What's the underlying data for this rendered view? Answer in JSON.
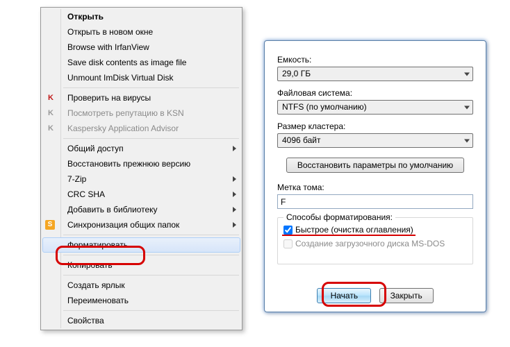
{
  "menu": {
    "items": [
      {
        "label": "Открыть",
        "bold": true
      },
      {
        "label": "Открыть в новом окне"
      },
      {
        "label": "Browse with IrfanView"
      },
      {
        "label": "Save disk contents as image file"
      },
      {
        "label": "Unmount ImDisk Virtual Disk"
      },
      {
        "sep": true
      },
      {
        "label": "Проверить на вирусы",
        "icon": "kas"
      },
      {
        "label": "Посмотреть репутацию в KSN",
        "icon": "kas2",
        "disabled": true
      },
      {
        "label": "Kaspersky Application Advisor",
        "icon": "kas2",
        "disabled": true
      },
      {
        "sep": true
      },
      {
        "label": "Общий доступ",
        "submenu": true
      },
      {
        "label": "Восстановить прежнюю версию"
      },
      {
        "label": "7-Zip",
        "submenu": true
      },
      {
        "label": "CRC SHA",
        "submenu": true
      },
      {
        "label": "Добавить в библиотеку",
        "submenu": true
      },
      {
        "label": "Синхронизация общих папок",
        "icon": "s",
        "submenu": true
      },
      {
        "sep": true
      },
      {
        "label": "Форматировать...",
        "highlight": true,
        "key": "format"
      },
      {
        "sep": true
      },
      {
        "label": "Копировать"
      },
      {
        "sep": true
      },
      {
        "label": "Создать ярлык"
      },
      {
        "label": "Переименовать"
      },
      {
        "sep": true
      },
      {
        "label": "Свойства"
      }
    ]
  },
  "dialog": {
    "capacity_label": "Емкость:",
    "capacity_value": "29,0 ГБ",
    "fs_label": "Файловая система:",
    "fs_value": "NTFS (по умолчанию)",
    "cluster_label": "Размер кластера:",
    "cluster_value": "4096 байт",
    "restore_defaults": "Восстановить параметры по умолчанию",
    "volume_label": "Метка тома:",
    "volume_value": "F",
    "group_label": "Способы форматирования:",
    "quick_format": "Быстрое (очистка оглавления)",
    "msdos_boot": "Создание загрузочного диска MS-DOS",
    "start": "Начать",
    "close": "Закрыть"
  }
}
